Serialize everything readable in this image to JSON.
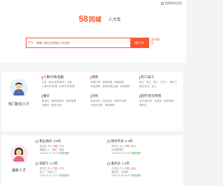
{
  "topbar": {
    "login": "免费发布信息"
  },
  "brand": {
    "num": "58",
    "city": "同城",
    "section": "人才库"
  },
  "search": {
    "scope": "职位",
    "placeholder": "请输入职位名称或公司名称",
    "button": "搜人才",
    "publish": "发布职位"
  },
  "hot_section": {
    "label": "热门职位人才",
    "categories": [
      {
        "title": "人事/行政/后勤",
        "items": [
          "文员",
          "前台/总机/接待",
          "后勤",
          "人事专员/助理",
          "行政专员/助理"
        ]
      },
      {
        "title": "销售",
        "items": [
          "销售代表",
          "销售助理",
          "网络销售",
          "电话销售",
          "销售经理/主管",
          "电话销售"
        ]
      },
      {
        "title": "普工/技工",
        "items": [
          "普工",
          "电工",
          "焊工",
          "叉车工",
          "操作工",
          "组长/拉长",
          "电工"
        ]
      },
      {
        "title": "餐饮",
        "items": [
          "服务员",
          "厨师/厨师长",
          "餐饮管理",
          "送餐员",
          "配菜/打荷"
        ]
      },
      {
        "title": "司机",
        "items": [
          "商务司机",
          "货运司机",
          "特种车司机",
          "出租车司机",
          "驾校教练"
        ]
      },
      {
        "title": "超市/百货/零售",
        "items": [
          "店员/营业员",
          "收银员",
          "促销/导购",
          "理货员"
        ]
      }
    ]
  },
  "new_section": {
    "label": "最新人才",
    "resumes": [
      {
        "name": "张先生",
        "age": "28",
        "title": "职业顾问",
        "exp": "3-5年",
        "salary": "不限",
        "edu": "大专",
        "want": "普通工人、司机、保安",
        "date": "2023-11-27 20:14",
        "status": "刚刚更新"
      },
      {
        "name": "陈先生",
        "age": "30",
        "title": "物流专员",
        "exp": "1-3年",
        "salary": "不限",
        "edu": "高中",
        "want": "仓库管理员",
        "date": "2023-11-20 14:13",
        "status": "刚刚更新"
      },
      {
        "name": "李先生",
        "age": "25",
        "title": "装配工",
        "exp": "1-3年",
        "salary": "不限",
        "edu": "中专",
        "want": "普工、车间工人",
        "date": "2023-11-27 21:17",
        "status": "刚刚更新"
      },
      {
        "name": "王先生",
        "age": "27",
        "title": "服务员",
        "exp": "1-3年",
        "salary": "不限",
        "edu": "高中",
        "want": "服务员、传菜员",
        "date": "2023-11-20 14:21",
        "status": "刚刚更新"
      }
    ]
  }
}
